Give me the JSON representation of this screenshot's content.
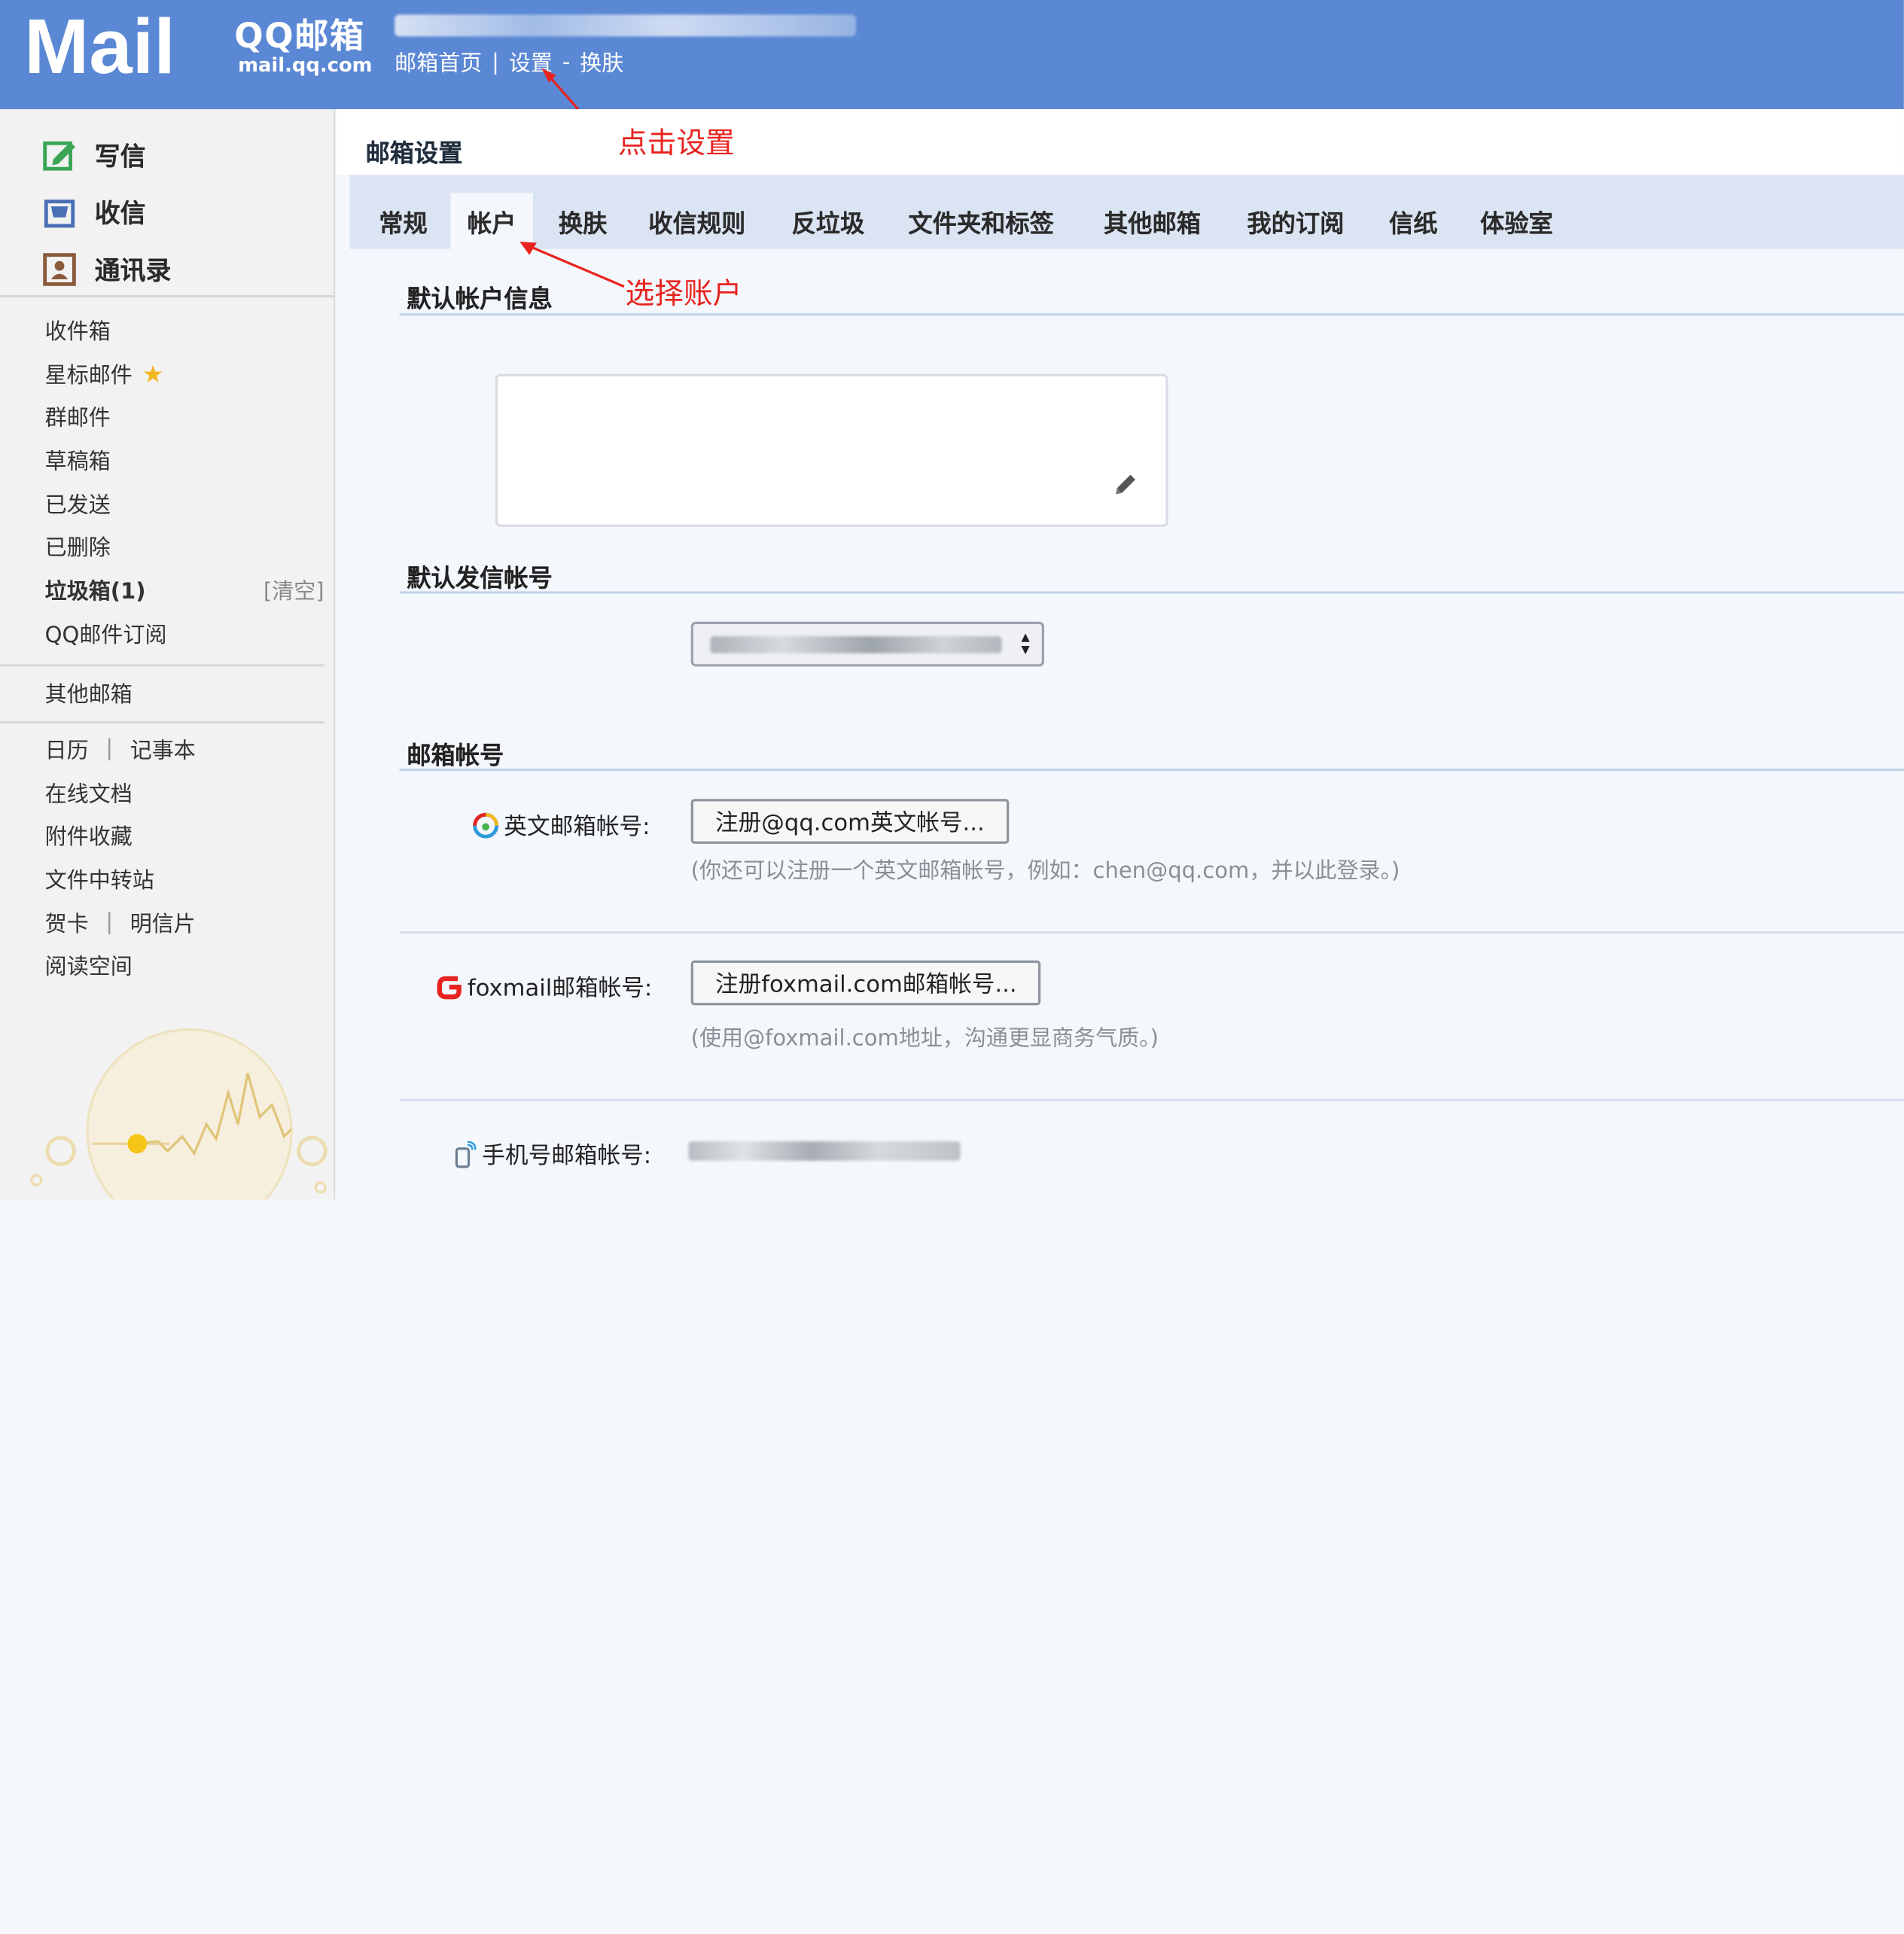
{
  "header": {
    "logo_text": "Mail",
    "brand": "QQ邮箱",
    "url": "mail.qq.com",
    "nav": {
      "home": "邮箱首页",
      "sep": "|",
      "settings": "设置",
      "dash": "-",
      "skin": "换肤"
    }
  },
  "sidebar": {
    "quick": [
      {
        "label": "写信",
        "icon": "compose-icon"
      },
      {
        "label": "收信",
        "icon": "inbox-tray-icon"
      },
      {
        "label": "通讯录",
        "icon": "contacts-icon"
      }
    ],
    "folders": [
      {
        "label": "收件箱"
      },
      {
        "label": "星标邮件"
      },
      {
        "label": "群邮件"
      },
      {
        "label": "草稿箱"
      },
      {
        "label": "已发送"
      },
      {
        "label": "已删除"
      },
      {
        "label": "垃圾箱(1)",
        "action": "[清空]"
      },
      {
        "label": "QQ邮件订阅"
      }
    ],
    "other_mailbox": "其他邮箱",
    "tools": {
      "calendar": "日历",
      "notebook": "记事本",
      "bar": "|",
      "docs": "在线文档",
      "attachments": "附件收藏",
      "transfer": "文件中转站",
      "card": "贺卡",
      "postcard": "明信片",
      "reading": "阅读空间"
    }
  },
  "main": {
    "title": "邮箱设置",
    "annotation_settings": "点击设置",
    "annotation_account": "选择账户",
    "tabs": [
      {
        "label": "常规"
      },
      {
        "label": "帐户"
      },
      {
        "label": "换肤"
      },
      {
        "label": "收信规则"
      },
      {
        "label": "反垃圾"
      },
      {
        "label": "文件夹和标签"
      },
      {
        "label": "其他邮箱"
      },
      {
        "label": "我的订阅"
      },
      {
        "label": "信纸"
      },
      {
        "label": "体验室"
      }
    ],
    "active_tab": "帐户",
    "sections": {
      "default_info": "默认帐户信息",
      "default_sender": "默认发信帐号",
      "accounts": "邮箱帐号"
    },
    "english": {
      "label": "英文邮箱帐号:",
      "button": "注册@qq.com英文帐号...",
      "hint": "(你还可以注册一个英文邮箱帐号，例如：chen@qq.com，并以此登录。)"
    },
    "foxmail": {
      "label": "foxmail邮箱帐号:",
      "button": "注册foxmail.com邮箱帐号...",
      "hint": "(使用@foxmail.com地址，沟通更显商务气质。)"
    },
    "phone": {
      "label": "手机号邮箱帐号:"
    }
  },
  "colors": {
    "header_bg": "#5b88d4",
    "annotation": "#e8231f",
    "tab_bar": "#dbe4f2"
  }
}
